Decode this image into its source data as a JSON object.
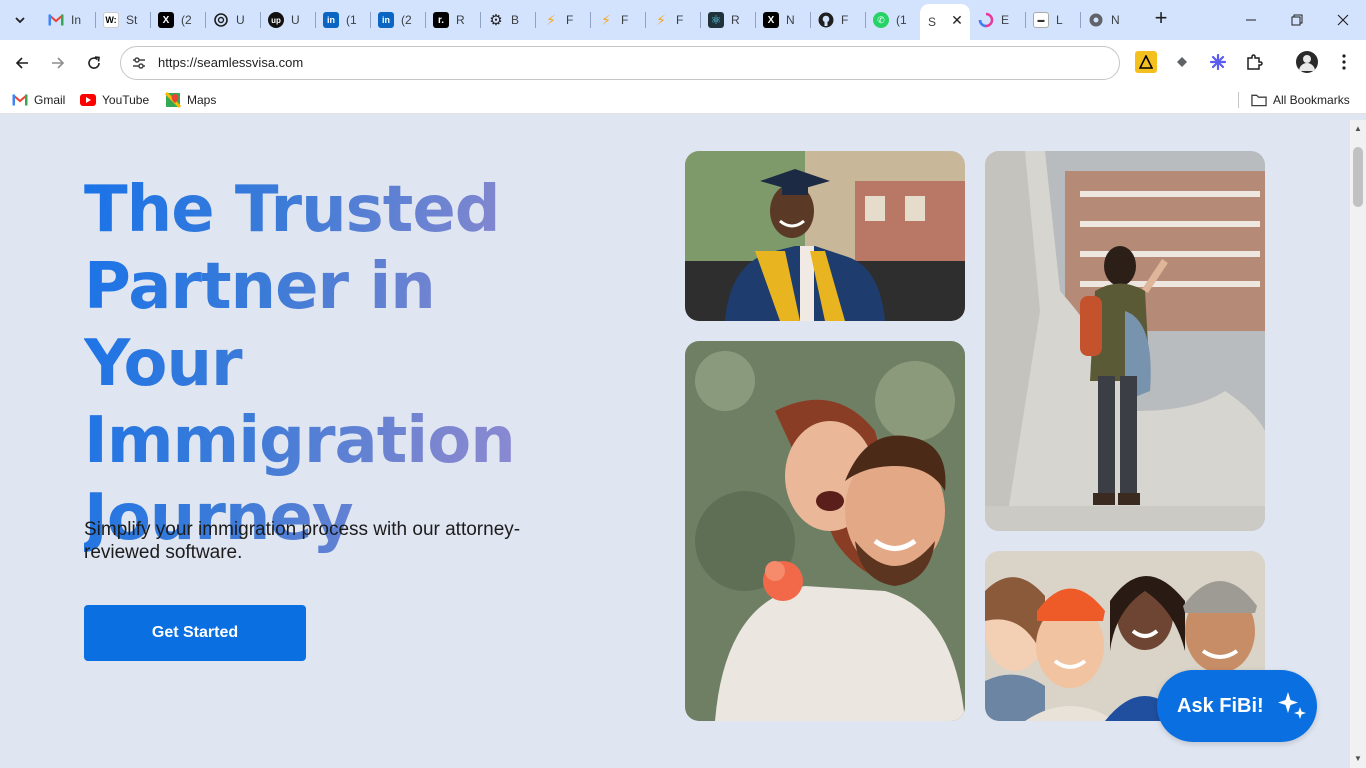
{
  "browser": {
    "tabs": [
      {
        "title": "In",
        "favicon": "gmail-icon"
      },
      {
        "title": "St",
        "favicon": "w-icon"
      },
      {
        "title": "(2",
        "favicon": "x-icon"
      },
      {
        "title": "U",
        "favicon": "openai-icon"
      },
      {
        "title": "U",
        "favicon": "upwork-icon"
      },
      {
        "title": "(1",
        "favicon": "linkedin-icon"
      },
      {
        "title": "(2",
        "favicon": "linkedin-icon"
      },
      {
        "title": "R",
        "favicon": "r-icon"
      },
      {
        "title": "B",
        "favicon": "gear-icon"
      },
      {
        "title": "F",
        "favicon": "bolt-icon"
      },
      {
        "title": "F",
        "favicon": "bolt-icon"
      },
      {
        "title": "F",
        "favicon": "bolt-icon"
      },
      {
        "title": "R",
        "favicon": "react-icon"
      },
      {
        "title": "N",
        "favicon": "x-icon"
      },
      {
        "title": "F",
        "favicon": "github-icon"
      },
      {
        "title": "(1",
        "favicon": "whatsapp-icon"
      },
      {
        "title": "S",
        "favicon": "seamless-icon",
        "active": true
      },
      {
        "title": "E",
        "favicon": "swirl-icon"
      },
      {
        "title": "L",
        "favicon": "l-icon"
      },
      {
        "title": "N",
        "favicon": "circle-icon"
      }
    ],
    "url": "https://seamlessvisa.com",
    "bookmarks": [
      {
        "label": "Gmail",
        "icon": "gmail-icon"
      },
      {
        "label": "YouTube",
        "icon": "youtube-icon"
      },
      {
        "label": "Maps",
        "icon": "maps-icon"
      }
    ],
    "all_bookmarks": "All Bookmarks"
  },
  "hero": {
    "title": "The Trusted Partner in Your Immigration Journey",
    "subtitle": "Simplify your immigration process with our attorney-reviewed software.",
    "cta": "Get Started"
  },
  "chat": {
    "label": "Ask FiBi!"
  },
  "colors": {
    "accent": "#0a6fe0",
    "page_bg": "#dfe5f1",
    "tabstrip_bg": "#d3e3fd"
  }
}
